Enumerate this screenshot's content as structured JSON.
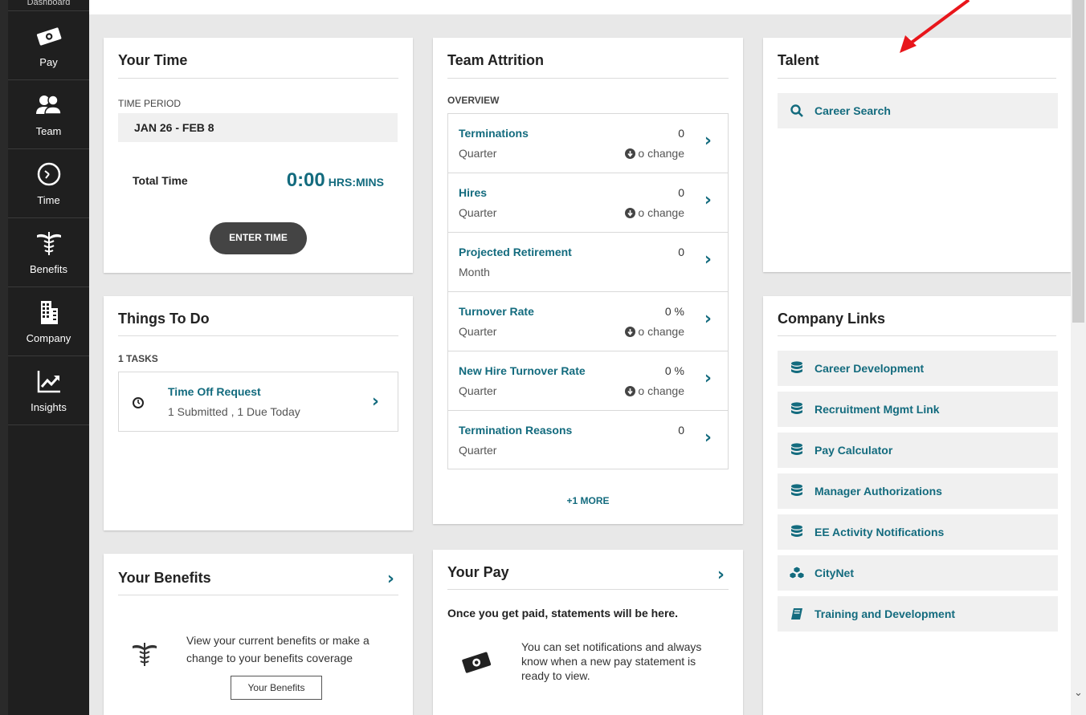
{
  "sidebar": {
    "top_label": "Dashboard",
    "items": [
      {
        "label": "Pay",
        "icon": "pay-icon"
      },
      {
        "label": "Team",
        "icon": "team-icon"
      },
      {
        "label": "Time",
        "icon": "clock-icon"
      },
      {
        "label": "Benefits",
        "icon": "caduceus-icon"
      },
      {
        "label": "Company",
        "icon": "building-icon"
      },
      {
        "label": "Insights",
        "icon": "chart-icon"
      }
    ]
  },
  "your_time": {
    "title": "Your Time",
    "period_label": "TIME PERIOD",
    "period_value": "JAN 26 - FEB 8",
    "total_label": "Total Time",
    "total_value": "0:00",
    "total_unit": "HRS:MINS",
    "button_label": "ENTER TIME"
  },
  "things_to_do": {
    "title": "Things To Do",
    "task_count": "1 TASKS",
    "task": {
      "title": "Time Off Request",
      "status": "1 Submitted , 1 Due Today"
    }
  },
  "your_benefits": {
    "title": "Your Benefits",
    "description": "View your current benefits or make a change to your benefits coverage",
    "tooltip": "Your Benefits"
  },
  "team_attrition": {
    "title": "Team Attrition",
    "overview_label": "OVERVIEW",
    "rows": [
      {
        "name": "Terminations",
        "period": "Quarter",
        "value": "0",
        "change": "o change"
      },
      {
        "name": "Hires",
        "period": "Quarter",
        "value": "0",
        "change": "o change"
      },
      {
        "name": "Projected Retirement",
        "period": "Month",
        "value": "0",
        "change": ""
      },
      {
        "name": "Turnover Rate",
        "period": "Quarter",
        "value": "0 %",
        "change": "o change"
      },
      {
        "name": "New Hire Turnover Rate",
        "period": "Quarter",
        "value": "0 %",
        "change": "o change"
      },
      {
        "name": "Termination Reasons",
        "period": "Quarter",
        "value": "0",
        "change": ""
      }
    ],
    "more_label": "+1 MORE"
  },
  "your_pay": {
    "title": "Your Pay",
    "headline": "Once you get paid, statements will be here.",
    "description": "You can set notifications and always know when a new pay statement is ready to view."
  },
  "talent": {
    "title": "Talent",
    "search_label": "Career Search"
  },
  "company_links": {
    "title": "Company Links",
    "links": [
      {
        "label": "Career Development",
        "icon": "database-icon"
      },
      {
        "label": "Recruitment Mgmt Link",
        "icon": "database-icon"
      },
      {
        "label": "Pay Calculator",
        "icon": "database-icon"
      },
      {
        "label": "Manager Authorizations",
        "icon": "database-icon"
      },
      {
        "label": "EE Activity Notifications",
        "icon": "database-icon"
      },
      {
        "label": "CityNet",
        "icon": "cubes-icon"
      },
      {
        "label": "Training and Development",
        "icon": "book-icon"
      }
    ]
  },
  "colors": {
    "accent": "#136b7e",
    "sidebar": "#1f1f1f",
    "annotation_arrow": "#e8161b"
  }
}
